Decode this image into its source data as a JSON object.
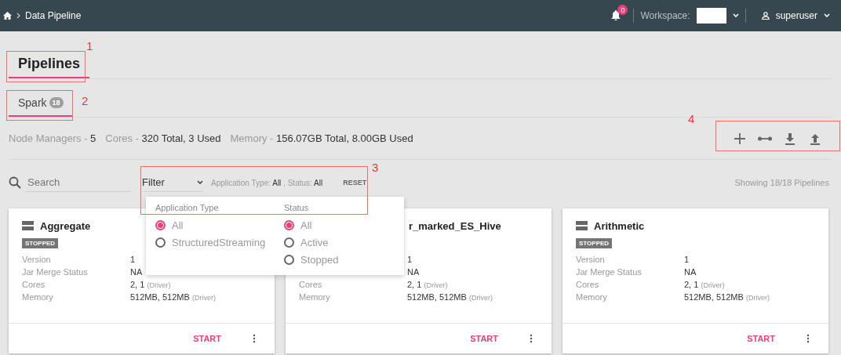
{
  "breadcrumb": {
    "items": [
      "Data Pipeline"
    ]
  },
  "notifications": {
    "count": "0"
  },
  "workspace": {
    "label": "Workspace:"
  },
  "user": {
    "name": "superuser"
  },
  "page_tabs": [
    {
      "label": "Pipelines",
      "selected": true
    }
  ],
  "engine_tabs": [
    {
      "label": "Spark",
      "count": "18",
      "selected": true
    }
  ],
  "stats": [
    {
      "label": "Node Managers -",
      "value": "5"
    },
    {
      "label": "Cores -",
      "value": "320 Total, 3 Used"
    },
    {
      "label": "Memory -",
      "value": "156.07GB Total, 8.00GB Used"
    }
  ],
  "search": {
    "placeholder": "Search"
  },
  "filter": {
    "label": "Filter",
    "expanded": true,
    "reset": "RESET",
    "summary": [
      {
        "kind": "label",
        "text": "Application Type:"
      },
      {
        "kind": "value",
        "text": "All"
      },
      {
        "kind": "label",
        "text": ","
      },
      {
        "kind": "label",
        "text": "Status:"
      },
      {
        "kind": "value",
        "text": "All"
      }
    ],
    "groups": [
      {
        "title": "Application Type",
        "options": [
          {
            "label": "All",
            "selected": true
          },
          {
            "label": "StructuredStreaming",
            "selected": false
          }
        ]
      },
      {
        "title": "Status",
        "options": [
          {
            "label": "All",
            "selected": true
          },
          {
            "label": "Active",
            "selected": false
          },
          {
            "label": "Stopped",
            "selected": false
          }
        ]
      }
    ]
  },
  "showing": "Showing 18/18 Pipelines",
  "cards": [
    {
      "title": "Aggregate",
      "icon": true,
      "status": "STOPPED",
      "rows": [
        {
          "label": "Version",
          "value": "1"
        },
        {
          "label": "Jar Merge Status",
          "value": "NA"
        },
        {
          "label": "Cores",
          "value": "2, 1",
          "note": "(Driver)"
        },
        {
          "label": "Memory",
          "value": "512MB, 512MB",
          "note": "(Driver)"
        }
      ],
      "action": "START"
    },
    {
      "title": "r_marked_ES_Hive",
      "icon": false,
      "rows": [
        {
          "value": "1"
        },
        {
          "value": "NA"
        },
        {
          "label": "Cores",
          "value": "2, 1",
          "note": "(Driver)"
        },
        {
          "label": "Memory",
          "value": "512MB, 512MB",
          "note": "(Driver)"
        }
      ],
      "action": "START"
    },
    {
      "title": "Arithmetic",
      "icon": true,
      "status": "STOPPED",
      "rows": [
        {
          "label": "Version",
          "value": "1"
        },
        {
          "label": "Jar Merge Status",
          "value": "NA"
        },
        {
          "label": "Cores",
          "value": "2, 1",
          "note": "(Driver)"
        },
        {
          "label": "Memory",
          "value": "512MB, 512MB",
          "note": "(Driver)"
        }
      ],
      "action": "START"
    }
  ],
  "annotations": [
    {
      "label": "1"
    },
    {
      "label": "2"
    },
    {
      "label": "3"
    },
    {
      "label": "4"
    }
  ]
}
